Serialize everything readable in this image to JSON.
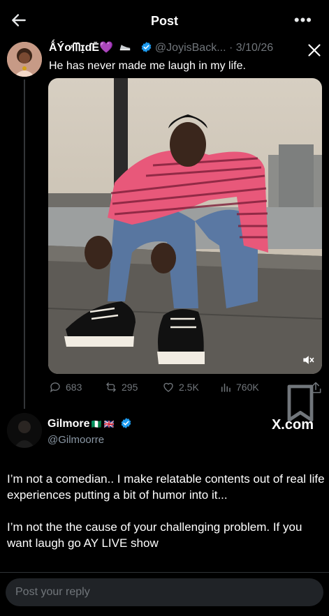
{
  "header": {
    "title": "Post"
  },
  "tweet": {
    "display_name": "ǺÝơᗰɪ̣ɗĒ",
    "name_emoji": "💜",
    "handle": "@JoyisBack...",
    "date": "· 3/10/26",
    "text": "He has never made me laugh in my life.",
    "stats": {
      "replies": "683",
      "reposts": "295",
      "likes": "2.5K",
      "views": "760K"
    }
  },
  "quoted": {
    "display_name": "Gilmore",
    "flags": "🇳🇬 🇬🇧",
    "handle": "@Gilmoorre",
    "source": "X.com",
    "paragraphs": [
      "I’m not a comedian.. I make relatable contents out of real life experiences putting a bit of humor into it...",
      "I’m not the the cause of your challenging problem. If you want laugh go AY LIVE show"
    ]
  },
  "reply": {
    "placeholder": "Post your reply"
  },
  "colors": {
    "background": "#000000",
    "verified": "#1d9bf0",
    "muted": "#71767b",
    "shirt": "#e8587a"
  }
}
